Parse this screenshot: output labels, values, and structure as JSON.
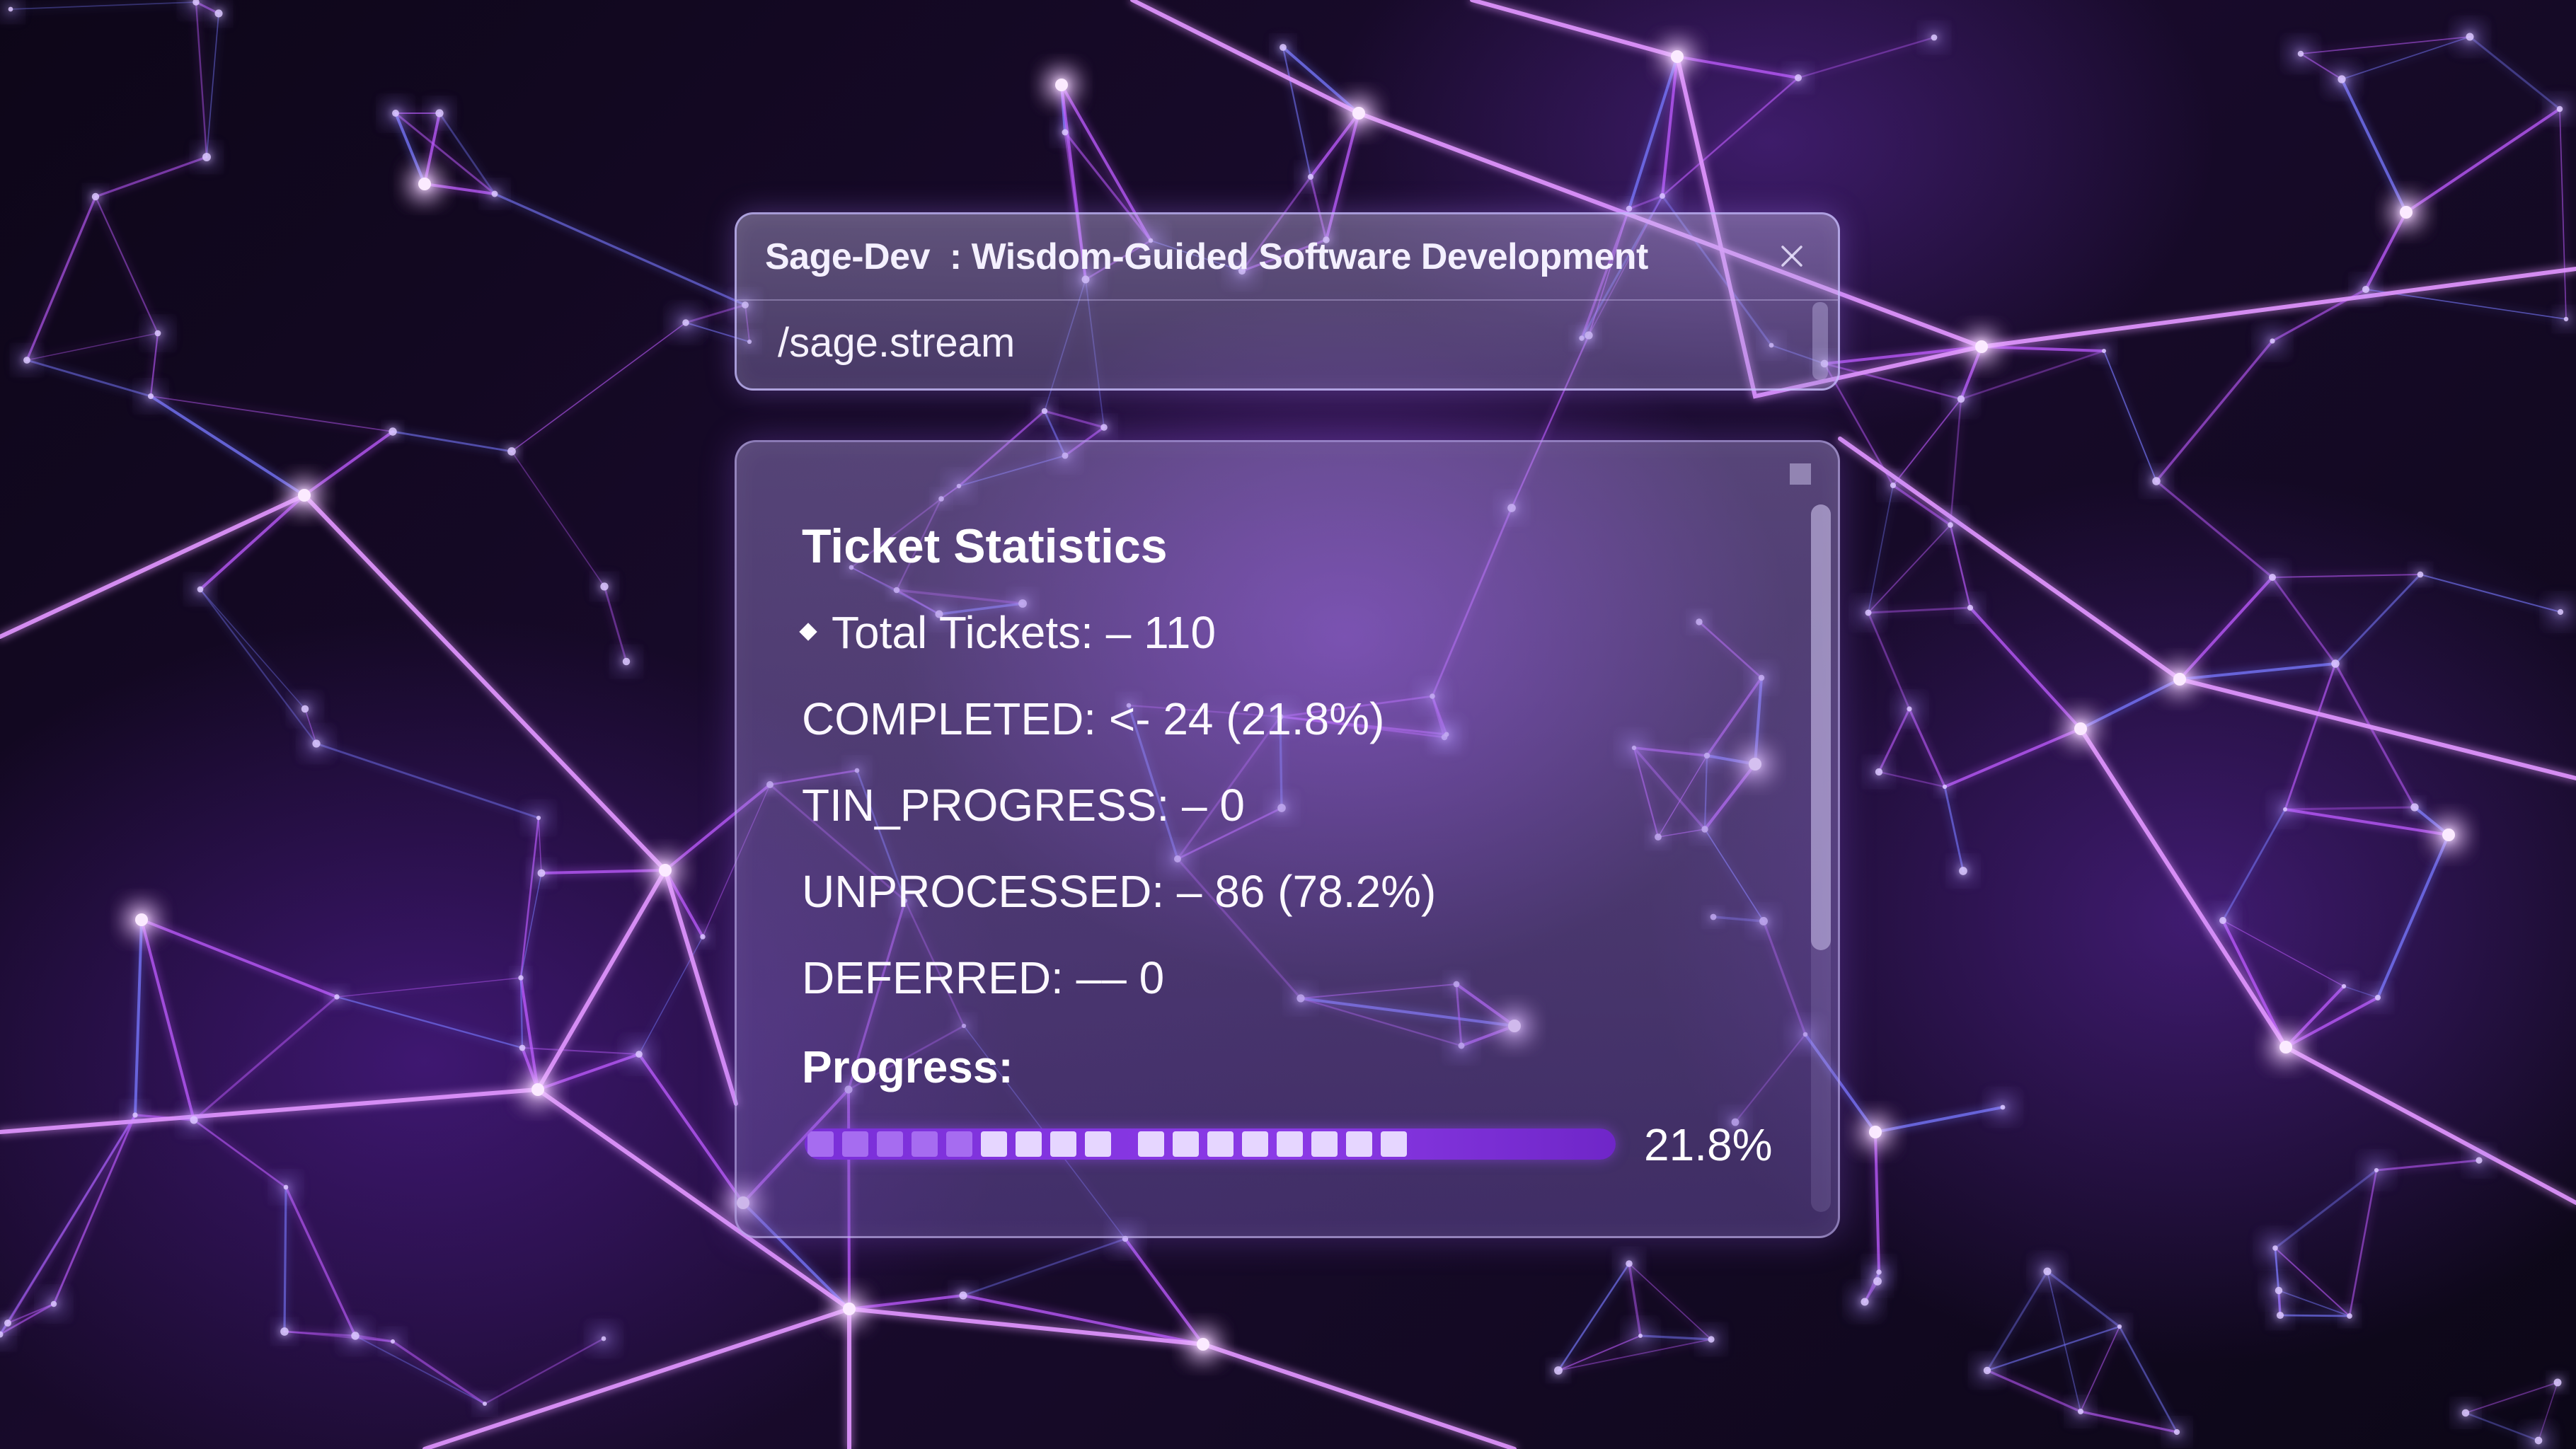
{
  "window": {
    "title": "Sage-Dev  : Wisdom-Guided Software Development",
    "command": "/sage.stream"
  },
  "stats": {
    "title": "Ticket Statistics",
    "total": "Total Tickets:  – 110",
    "completed": "COMPLETED:  <- 24 (21.8%)",
    "in_progress": "TIN_PROGRESS:  – 0",
    "unprocessed": "UNPROCESSED:  – 86 (78.2%)",
    "deferred": "DEFERRED:  –– 0"
  },
  "progress": {
    "title": "Progress:",
    "value_label": "21.8%",
    "fraction": 0.218
  },
  "icons": {
    "close": "close-icon",
    "bullet": "diamond-bullet-icon"
  },
  "colors": {
    "accent": "#8b3ae6",
    "segment_dark": "#a66cf0",
    "segment_light": "#e6d6ff"
  }
}
